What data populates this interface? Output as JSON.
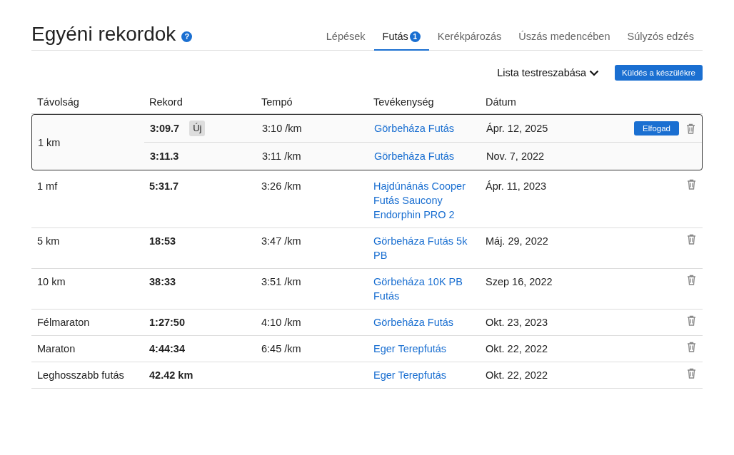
{
  "header": {
    "title": "Egyéni rekordok",
    "help": "?"
  },
  "tabs": [
    {
      "label": "Lépések",
      "selected": false
    },
    {
      "label": "Futás",
      "selected": true,
      "badge": "1"
    },
    {
      "label": "Kerékpározás",
      "selected": false
    },
    {
      "label": "Úszás medencében",
      "selected": false
    },
    {
      "label": "Súlyzós edzés",
      "selected": false
    }
  ],
  "toolbar": {
    "customize": "Lista testreszabása",
    "send": "Küldés a készülékre"
  },
  "table": {
    "columns": [
      "Távolság",
      "Rekord",
      "Tempó",
      "Tevékenység",
      "Dátum"
    ],
    "rows": [
      {
        "distance": "1 km",
        "pending": true,
        "entries": [
          {
            "record": "3:09.7",
            "badge": "Új",
            "pace": "3:10 /km",
            "activity": "Görbeháza Futás",
            "date": "Ápr. 12, 2025",
            "action": "Elfogad",
            "deletable": true
          },
          {
            "record": "3:11.3",
            "pace": "3:11 /km",
            "activity": "Görbeháza Futás",
            "date": "Nov. 7, 2022",
            "deletable": false
          }
        ]
      },
      {
        "distance": "1 mf",
        "pending": false,
        "entries": [
          {
            "record": "5:31.7",
            "pace": "3:26 /km",
            "activity": "Hajdúnánás Cooper Futás Saucony Endorphin PRO 2",
            "date": "Ápr. 11, 2023",
            "deletable": true
          }
        ]
      },
      {
        "distance": "5 km",
        "pending": false,
        "entries": [
          {
            "record": "18:53",
            "pace": "3:47 /km",
            "activity": "Görbeháza Futás 5k PB",
            "date": "Máj. 29, 2022",
            "deletable": true
          }
        ]
      },
      {
        "distance": "10 km",
        "pending": false,
        "entries": [
          {
            "record": "38:33",
            "pace": "3:51 /km",
            "activity": "Görbeháza 10K PB Futás",
            "date": "Szep 16, 2022",
            "deletable": true
          }
        ]
      },
      {
        "distance": "Félmaraton",
        "pending": false,
        "entries": [
          {
            "record": "1:27:50",
            "pace": "4:10 /km",
            "activity": "Görbeháza Futás",
            "date": "Okt. 23, 2023",
            "deletable": true
          }
        ]
      },
      {
        "distance": "Maraton",
        "pending": false,
        "entries": [
          {
            "record": "4:44:34",
            "pace": "6:45 /km",
            "activity": "Eger Terepfutás",
            "date": "Okt. 22, 2022",
            "deletable": true
          }
        ]
      },
      {
        "distance": "Leghosszabb futás",
        "pending": false,
        "entries": [
          {
            "record": "42.42 km",
            "activity": "Eger Terepfutás",
            "date": "Okt. 22, 2022",
            "deletable": true
          }
        ]
      }
    ]
  }
}
